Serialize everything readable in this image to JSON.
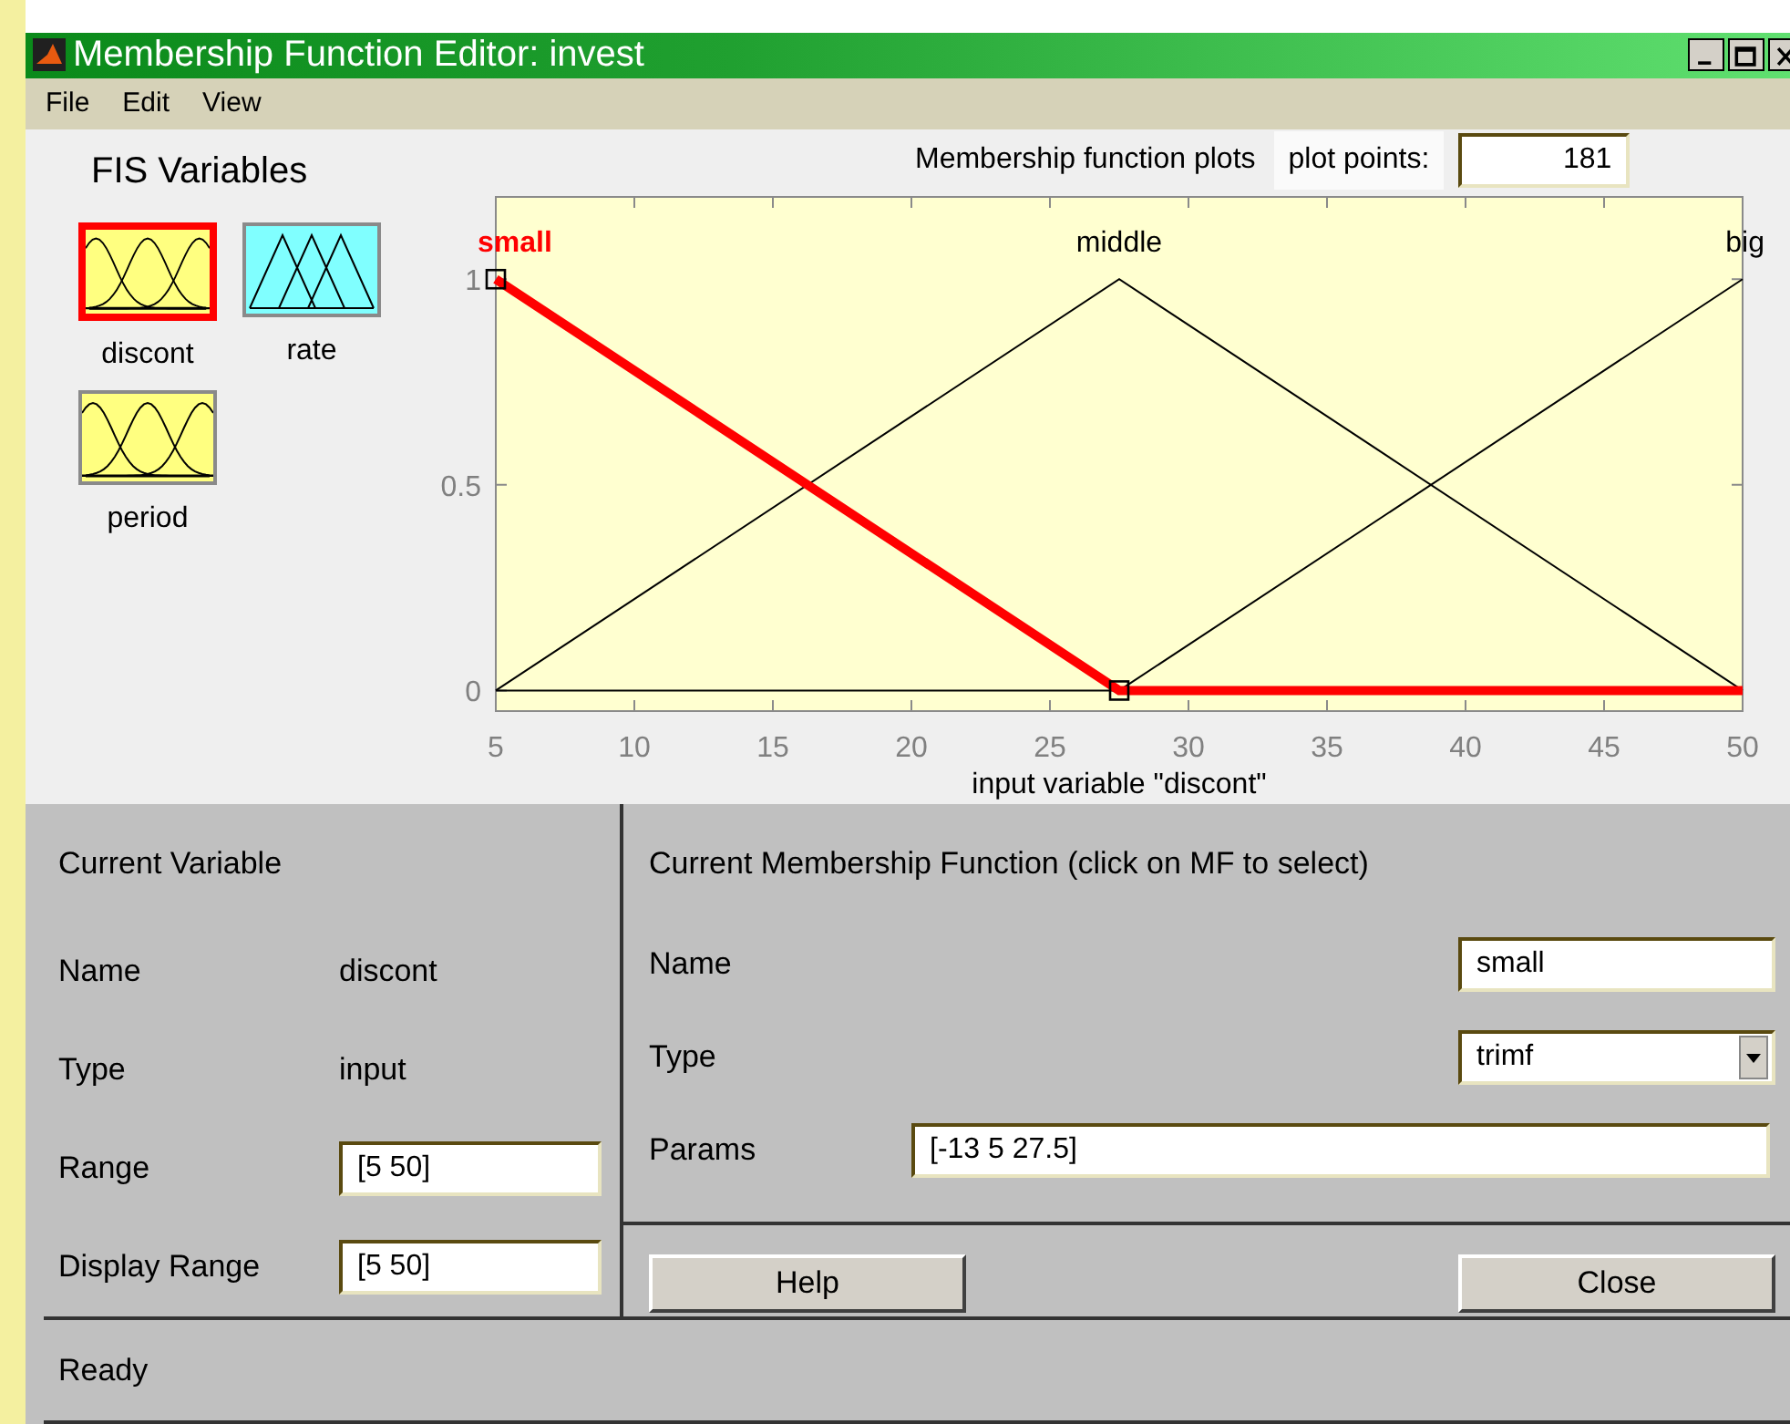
{
  "window": {
    "title": "Membership Function Editor: invest"
  },
  "menu": [
    "File",
    "Edit",
    "View"
  ],
  "fis_variables": {
    "title": "FIS Variables",
    "items": [
      {
        "name": "discont",
        "kind": "gauss",
        "color": "#ffff80",
        "selected": true
      },
      {
        "name": "rate",
        "kind": "triangle",
        "color": "#80ffff",
        "selected": false
      },
      {
        "name": "period",
        "kind": "gauss",
        "color": "#ffff80",
        "selected": false
      }
    ]
  },
  "plot": {
    "title": "Membership function plots",
    "plot_points_label": "plot points:",
    "plot_points": "181",
    "chart_data": {
      "type": "line",
      "xlabel": "input variable \"discont\"",
      "x": [
        5,
        27.5,
        50
      ],
      "series": [
        {
          "name": "small",
          "color": "#ff0000",
          "values": [
            1,
            0,
            0
          ]
        },
        {
          "name": "middle",
          "color": "#000000",
          "values": [
            0,
            1,
            0
          ]
        },
        {
          "name": "big",
          "color": "#000000",
          "values": [
            0,
            0,
            1
          ]
        }
      ],
      "xlim": [
        5,
        50
      ],
      "ylim": [
        -0.05,
        1.2
      ],
      "xticks": [
        5,
        10,
        15,
        20,
        25,
        30,
        35,
        40,
        45,
        50
      ],
      "yticks": [
        0,
        0.5,
        1
      ]
    },
    "membership_functions": [
      {
        "selected": true
      },
      {
        "selected": false
      },
      {
        "selected": false
      }
    ]
  },
  "current_variable": {
    "title": "Current Variable",
    "fields": [
      {
        "label": "Name",
        "value": "discont",
        "kind": "text"
      },
      {
        "label": "Type",
        "value": "input",
        "kind": "text"
      },
      {
        "label": "Range",
        "value": "[5 50]",
        "kind": "input"
      },
      {
        "label": "Display Range",
        "value": "[5 50]",
        "kind": "input"
      }
    ]
  },
  "current_mf": {
    "title": "Current Membership Function (click on MF to select)",
    "fields": [
      {
        "label": "Name",
        "value": "small",
        "kind": "input"
      },
      {
        "label": "Type",
        "value": "trimf",
        "kind": "dropdown"
      },
      {
        "label": "Params",
        "value": "[-13 5 27.5]",
        "kind": "wide-input"
      }
    ]
  },
  "buttons": [
    "Help",
    "Close"
  ],
  "status_bar": "Ready"
}
